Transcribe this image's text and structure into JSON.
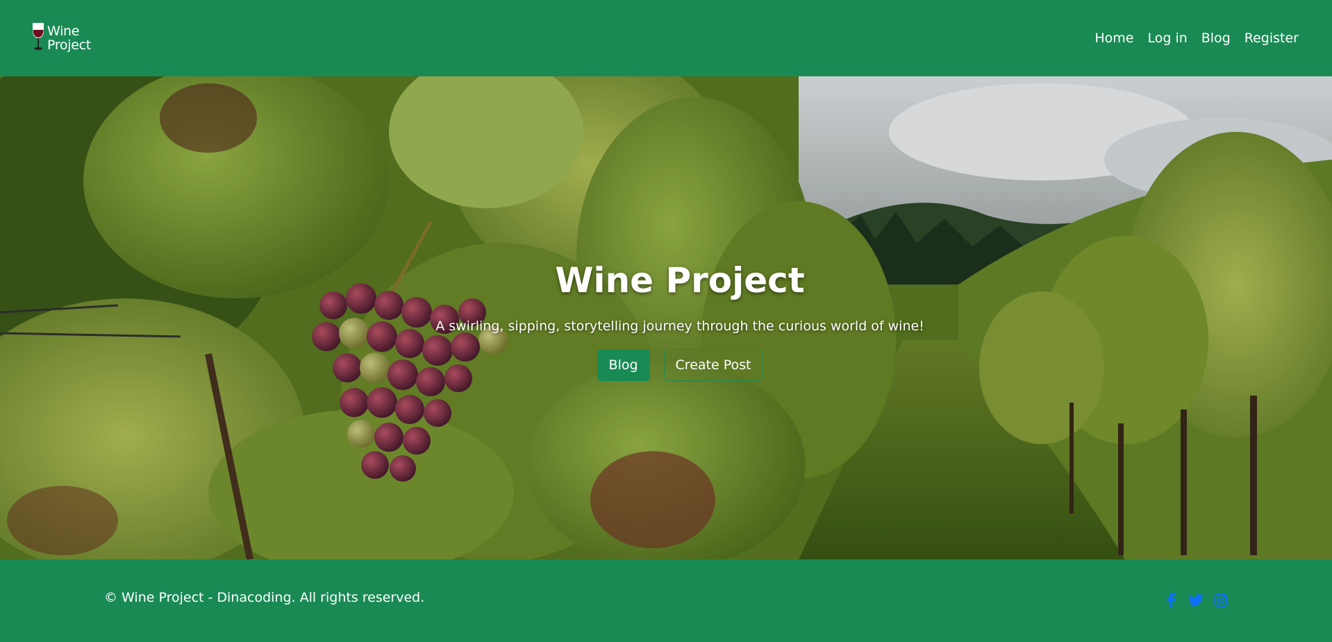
{
  "brand": {
    "line1": "Wine",
    "line2": "Project",
    "logo_icon": "wine-glass-icon"
  },
  "nav": {
    "items": [
      {
        "label": "Home"
      },
      {
        "label": "Log in"
      },
      {
        "label": "Blog"
      },
      {
        "label": "Register"
      }
    ]
  },
  "hero": {
    "title": "Wine Project",
    "subtitle": "A swirling, sipping, storytelling journey through the curious world of wine!",
    "primary_button": "Blog",
    "secondary_button": "Create Post",
    "background": "vineyard photo with grape cluster"
  },
  "footer": {
    "copyright": "© Wine Project - Dinacoding. All rights reserved.",
    "socials": [
      "facebook-icon",
      "twitter-icon",
      "instagram-icon"
    ],
    "social_color": "#0d6efd"
  },
  "colors": {
    "brand_green": "#1a8a55",
    "text": "#ffffff"
  }
}
